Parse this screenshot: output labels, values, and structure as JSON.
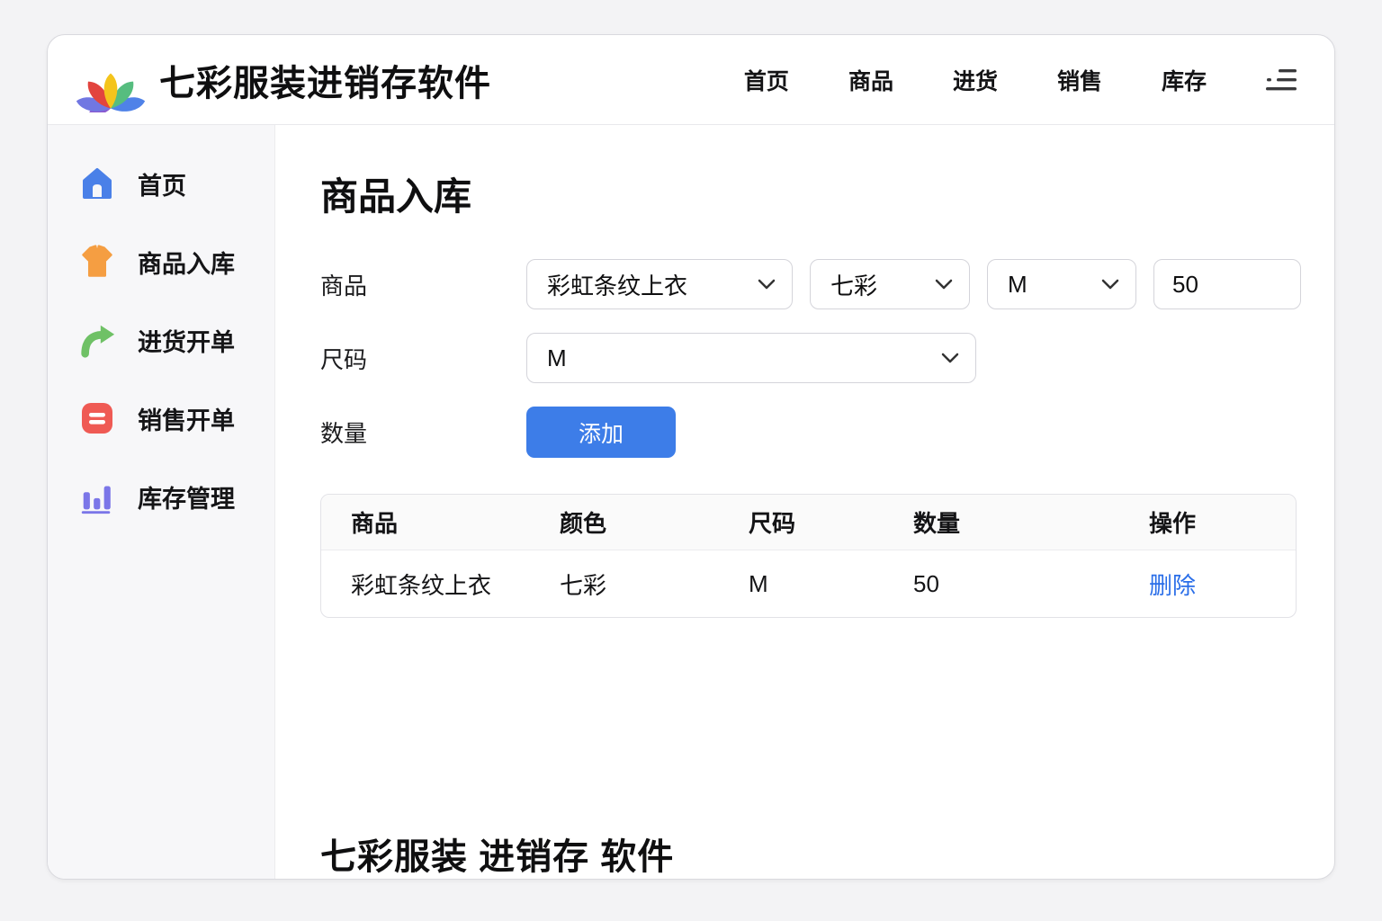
{
  "colors": {
    "accent_blue": "#3d7de8",
    "link_blue": "#2a6ee8",
    "home_icon_blue": "#4a80e8",
    "shirt_icon_orange": "#f59e42",
    "arrow_icon_green": "#6fc166",
    "sales_icon_red": "#ef5a54",
    "chart_icon_purple": "#7b76e8"
  },
  "header": {
    "title": "七彩服装进销存软件",
    "nav": [
      {
        "label": "首页"
      },
      {
        "label": "商品"
      },
      {
        "label": "进货"
      },
      {
        "label": "销售"
      },
      {
        "label": "库存"
      }
    ]
  },
  "sidebar": {
    "items": [
      {
        "icon": "home-icon",
        "label": "首页"
      },
      {
        "icon": "shirt-icon",
        "label": "商品入库"
      },
      {
        "icon": "purchase-arrow-icon",
        "label": "进货开单"
      },
      {
        "icon": "sales-card-icon",
        "label": "销售开单"
      },
      {
        "icon": "bar-chart-icon",
        "label": "库存管理"
      }
    ]
  },
  "main": {
    "title": "商品入库",
    "form": {
      "product_label": "商品",
      "size_label": "尺码",
      "quantity_label": "数量",
      "product_value": "彩虹条纹上衣",
      "color_value": "七彩",
      "size_small_value": "M",
      "quantity_value": "50",
      "size_value": "M",
      "add_button": "添加"
    },
    "table": {
      "headers": [
        "商品",
        "颜色",
        "尺码",
        "数量",
        "操作"
      ],
      "rows": [
        {
          "product": "彩虹条纹上衣",
          "color": "七彩",
          "size": "M",
          "quantity": "50",
          "action": "删除"
        }
      ]
    },
    "footer": "七彩服装 进销存 软件"
  }
}
